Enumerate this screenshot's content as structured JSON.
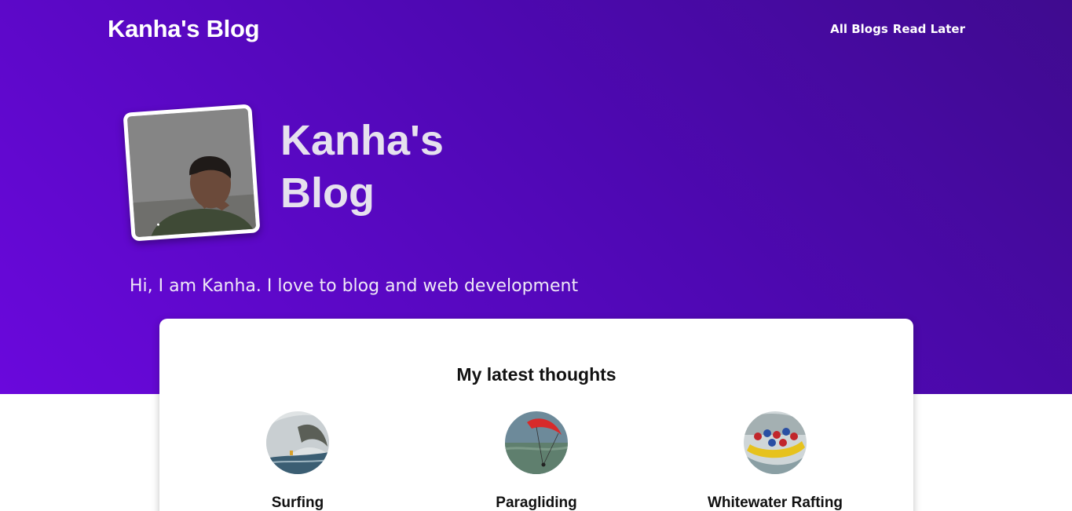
{
  "header": {
    "brand": "Kanha's Blog",
    "nav": [
      {
        "label": "All Blogs"
      },
      {
        "label": "Read Later"
      }
    ]
  },
  "hero": {
    "title": "Kanha's Blog",
    "tagline": "Hi, I am Kanha. I love to blog and web development"
  },
  "latest": {
    "heading": "My latest thoughts",
    "posts": [
      {
        "title": "Surfing",
        "icon": "surfing-thumbnail"
      },
      {
        "title": "Paragliding",
        "icon": "paragliding-thumbnail"
      },
      {
        "title": "Whitewater Rafting",
        "icon": "rafting-thumbnail"
      }
    ]
  },
  "colors": {
    "hero_gradient_start": "#3f0b8f",
    "hero_gradient_end": "#6a08dc",
    "text_on_hero": "#ffffff",
    "card_bg": "#ffffff"
  }
}
